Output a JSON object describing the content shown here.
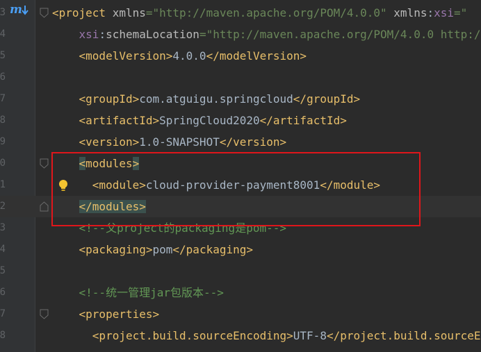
{
  "gutter": {
    "maven_icon_label": "m",
    "line_numbers": [
      "3",
      "4",
      "5",
      "6",
      "7",
      "8",
      "9",
      "0",
      "1",
      "2",
      "3",
      "4",
      "5",
      "6",
      "7",
      "8"
    ]
  },
  "lines": [
    {
      "parts": [
        [
          "t",
          "<project "
        ],
        [
          "a",
          "xmlns"
        ],
        [
          "v",
          "=\"http://maven.apache.org/POM/4.0.0\" "
        ],
        [
          "a",
          "xmlns"
        ],
        [
          "tx",
          ":"
        ],
        [
          "ns",
          "xsi"
        ],
        [
          "v",
          "=\""
        ]
      ]
    },
    {
      "parts": [
        [
          "tx",
          "    "
        ],
        [
          "ns",
          "xsi"
        ],
        [
          "tx",
          ":"
        ],
        [
          "a",
          "schemaLocation"
        ],
        [
          "v",
          "=\"http://maven.apache.org/POM/4.0.0 http:/"
        ]
      ]
    },
    {
      "parts": [
        [
          "tx",
          "    "
        ],
        [
          "t",
          "<modelVersion>"
        ],
        [
          "tx",
          "4.0.0"
        ],
        [
          "t",
          "</modelVersion>"
        ]
      ]
    },
    {
      "parts": []
    },
    {
      "parts": [
        [
          "tx",
          "    "
        ],
        [
          "t",
          "<groupId>"
        ],
        [
          "tx",
          "com.atguigu.springcloud"
        ],
        [
          "t",
          "</groupId>"
        ]
      ]
    },
    {
      "parts": [
        [
          "tx",
          "    "
        ],
        [
          "t",
          "<artifactId>"
        ],
        [
          "tx",
          "SpringCloud2020"
        ],
        [
          "t",
          "</artifactId>"
        ]
      ]
    },
    {
      "parts": [
        [
          "tx",
          "    "
        ],
        [
          "t",
          "<version>"
        ],
        [
          "tx",
          "1.0-SNAPSHOT"
        ],
        [
          "t",
          "</version>"
        ]
      ]
    },
    {
      "parts": [
        [
          "tx",
          "    "
        ],
        [
          "hl",
          "<"
        ],
        [
          "t",
          "modules"
        ],
        [
          "hl",
          ">"
        ]
      ]
    },
    {
      "parts": [
        [
          "tx",
          "      "
        ],
        [
          "t",
          "<module>"
        ],
        [
          "tx",
          "cloud-provider-payment8001"
        ],
        [
          "t",
          "</module>"
        ]
      ]
    },
    {
      "parts": [
        [
          "tx",
          "    "
        ],
        [
          "hl",
          "</modules>"
        ]
      ]
    },
    {
      "parts": [
        [
          "tx",
          "    "
        ],
        [
          "cm",
          "<!--父project的packaging是pom-->"
        ]
      ]
    },
    {
      "parts": [
        [
          "tx",
          "    "
        ],
        [
          "t",
          "<packaging>"
        ],
        [
          "tx",
          "pom"
        ],
        [
          "t",
          "</packaging>"
        ]
      ]
    },
    {
      "parts": []
    },
    {
      "parts": [
        [
          "tx",
          "    "
        ],
        [
          "cm",
          "<!--统一管理jar包版本-->"
        ]
      ]
    },
    {
      "parts": [
        [
          "tx",
          "    "
        ],
        [
          "t",
          "<properties>"
        ]
      ]
    },
    {
      "parts": [
        [
          "tx",
          "      "
        ],
        [
          "t",
          "<project.build.sourceEncoding>"
        ],
        [
          "tx",
          "UTF-8"
        ],
        [
          "t",
          "</project.build.sourceE"
        ]
      ]
    }
  ],
  "colors": {
    "background": "#2b2b2b",
    "tag": "#e8bf6a",
    "attribute_value": "#6a8759",
    "comment": "#629755",
    "highlight_box": "#e0161b"
  },
  "icons": [
    "maven-icon",
    "reload-arrow-icon",
    "intention-bulb-icon",
    "fold-marker-icon"
  ]
}
